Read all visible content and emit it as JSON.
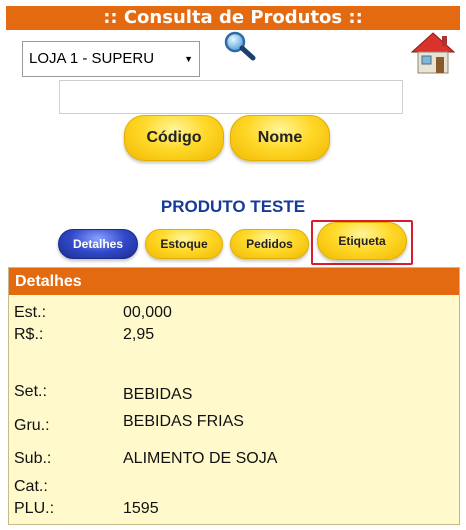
{
  "header": {
    "title": ":: Consulta de Produtos ::"
  },
  "search": {
    "store_selected": "LOJA 1 - SUPERU",
    "query_value": "",
    "btn_codigo": "Código",
    "btn_nome": "Nome"
  },
  "product": {
    "name": "PRODUTO TESTE"
  },
  "tabs": [
    {
      "label": "Detalhes",
      "active": true
    },
    {
      "label": "Estoque",
      "active": false
    },
    {
      "label": "Pedidos",
      "active": false
    },
    {
      "label": "Etiqueta",
      "active": false,
      "highlighted": true
    }
  ],
  "details": {
    "title": "Detalhes",
    "rows": [
      {
        "label": "Est.:",
        "value": "00,000"
      },
      {
        "label": "R$.:",
        "value": "2,95"
      },
      {
        "label": "Set.:",
        "value": "BEBIDAS"
      },
      {
        "label": "Gru.:",
        "value": "BEBIDAS FRIAS"
      },
      {
        "label": "Sub.:",
        "value": "ALIMENTO DE SOJA"
      },
      {
        "label": "Cat.:",
        "value": ""
      },
      {
        "label": "PLU.:",
        "value": "1595"
      }
    ]
  },
  "colors": {
    "header_bg": "#e36a10",
    "panel_bg": "#fff9cc",
    "accent_blue": "#173b96",
    "highlight_red": "#d81c2b"
  }
}
